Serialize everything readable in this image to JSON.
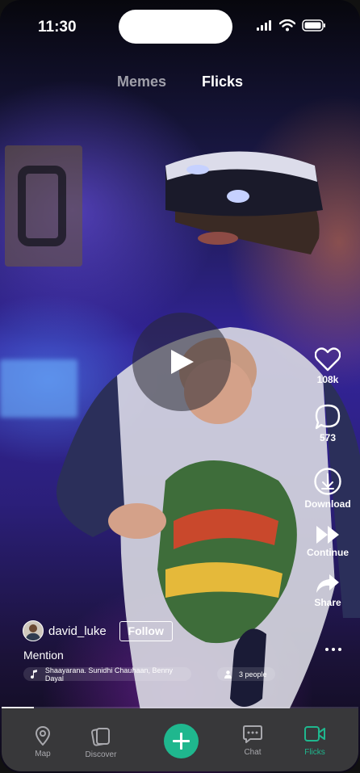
{
  "status": {
    "time": "11:30"
  },
  "tabs": [
    {
      "label": "Memes",
      "active": false
    },
    {
      "label": "Flicks",
      "active": true
    }
  ],
  "actions": {
    "likes": "108k",
    "comments": "573",
    "download_label": "Download",
    "continue_label": "Continue",
    "share_label": "Share"
  },
  "post": {
    "username": "david_luke",
    "follow_label": "Follow",
    "caption": "Mention",
    "music": "Shaayarana. Sunidhi Chauhaan, Benny Dayal",
    "people": "3 people"
  },
  "playback": {
    "progress": 0.09
  },
  "bottom_nav": [
    {
      "label": "Map",
      "icon": "map-pin-icon",
      "active": false
    },
    {
      "label": "Discover",
      "icon": "discover-cards-icon",
      "active": false
    },
    {
      "label": "",
      "icon": "plus-icon",
      "active": false
    },
    {
      "label": "Chat",
      "icon": "chat-icon",
      "active": false
    },
    {
      "label": "Flicks",
      "icon": "video-camera-icon",
      "active": true
    }
  ],
  "colors": {
    "accent": "#1fb78e",
    "navbar": "#38383a",
    "nav_inactive": "#a8a8ad"
  }
}
